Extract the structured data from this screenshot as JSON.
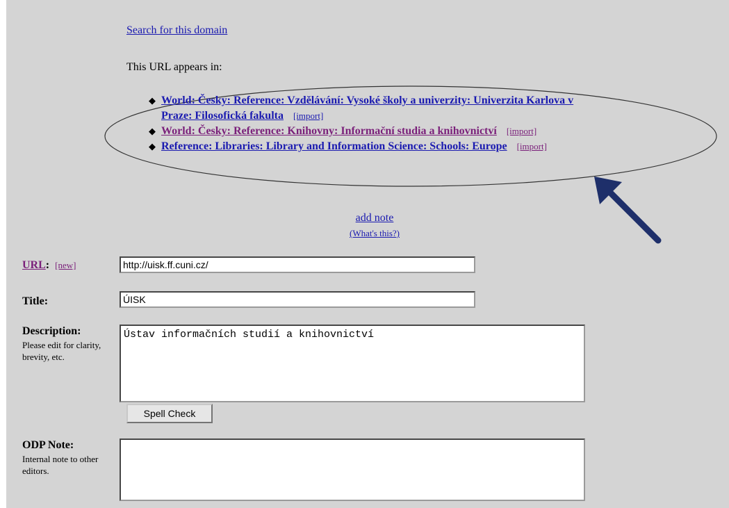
{
  "search_link": "Search for this domain",
  "appears_text": "This URL appears in:",
  "appears_items": [
    {
      "label_line1": "World: Česky: Reference: Vzdělávání: Vysoké školy a univerzity: Univerzita Karlova v",
      "label_line2": "Praze: Filosofická fakulta",
      "import": "[import]"
    },
    {
      "label_line1": "World: Česky: Reference: Knihovny: Informační studia a knihovnictví",
      "import": "[import]"
    },
    {
      "label_line1": "Reference: Libraries: Library and Information Science: Schools: Europe",
      "import": "[import]"
    }
  ],
  "add_note": "add note",
  "whats_this": "(What's this?)",
  "url": {
    "label": "URL",
    "colon": ":",
    "new_link": "[new]",
    "value": "http://uisk.ff.cuni.cz/"
  },
  "title": {
    "label": "Title:",
    "value": "ÚISK"
  },
  "description": {
    "label": "Description:",
    "hint": "Please edit for clarity, brevity, etc.",
    "value": "Ústav informačních studií a knihovnictví"
  },
  "spell_check_label": "Spell Check",
  "odp_note": {
    "label": "ODP Note:",
    "hint": "Internal note to other editors.",
    "value": ""
  },
  "colors": {
    "panel": "#d4d4d4",
    "link": "#1a1ab0",
    "visited": "#7a1f7a",
    "arrow": "#1e2f6a"
  }
}
